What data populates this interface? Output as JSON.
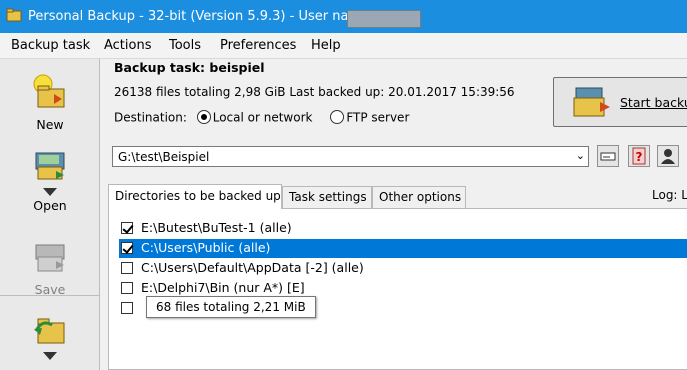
{
  "titlebar": {
    "title": "Personal Backup - 32-bit (Version 5.9.3) - User name:"
  },
  "menu": [
    "Backup task",
    "Actions",
    "Tools",
    "Preferences",
    "Help"
  ],
  "sidebar": {
    "new_label": "New",
    "open_label": "Open",
    "save_label": "Save"
  },
  "task": {
    "title": "Backup task: beispiel",
    "stats": "26138 files totaling 2,98 GiB   Last backed up:  20.01.2017 15:39:56",
    "destination_label": "Destination:",
    "dest_local": "Local or network",
    "dest_ftp": "FTP server",
    "start_label": "Start backu"
  },
  "path": {
    "value": "G:\\test\\Beispiel"
  },
  "tabs": [
    "Directories to be backed up",
    "Task settings",
    "Other options"
  ],
  "log_label": "Log: L",
  "directories": [
    {
      "label": "E:\\Butest\\BuTest-1 (alle)",
      "checked": true,
      "selected": false
    },
    {
      "label": "C:\\Users\\Public (alle)",
      "checked": true,
      "selected": true
    },
    {
      "label": "C:\\Users\\Default\\AppData [-2] (alle)",
      "checked": false,
      "selected": false
    },
    {
      "label": "E:\\Delphi7\\Bin (nur A*) [E]",
      "checked": false,
      "selected": false
    },
    {
      "label": "",
      "checked": false,
      "selected": false
    }
  ],
  "tooltip": "68 files totaling 2,21 MiB",
  "colors": {
    "titlebar": "#1c8ee0",
    "selection": "#0078d7"
  }
}
